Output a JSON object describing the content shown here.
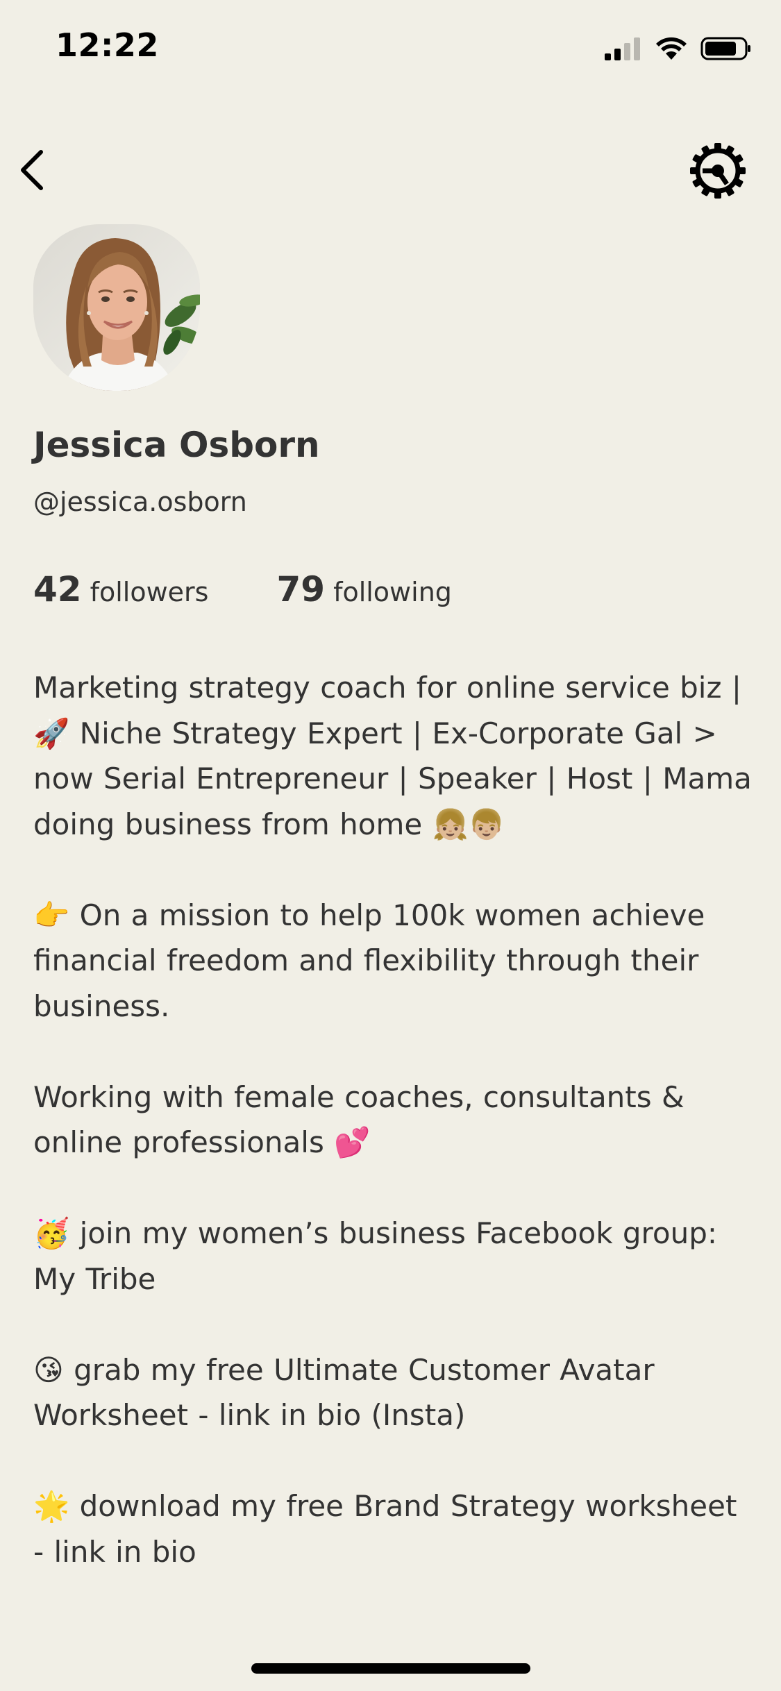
{
  "status_bar": {
    "time": "12:22"
  },
  "profile": {
    "name": "Jessica Osborn",
    "handle": "@jessica.osborn",
    "followers_count": "42",
    "followers_label": "followers",
    "following_count": "79",
    "following_label": "following"
  },
  "bio": {
    "paragraphs": [
      "Marketing strategy coach for online service biz | 🚀 Niche Strategy Expert | Ex-Corporate Gal > now Serial Entrepreneur | Speaker | Host | Mama doing business from home 👧🏼👦🏼",
      "👉 On a mission to help 100k women achieve financial freedom and flexibility through their business.",
      "Working with female coaches, consultants & online professionals 💕",
      "🥳 join my women’s business Facebook group: My Tribe",
      "😘 grab my free Ultimate Customer Avatar Worksheet - link in bio (Insta)",
      "🌟 download my free Brand Strategy worksheet - link in bio"
    ]
  },
  "icons": {
    "back": "chevron-left-icon",
    "settings": "gear-icon",
    "signal": "cellular-signal-icon",
    "wifi": "wifi-icon",
    "battery": "battery-icon"
  },
  "colors": {
    "background": "#f1efe6",
    "text": "#333333"
  }
}
